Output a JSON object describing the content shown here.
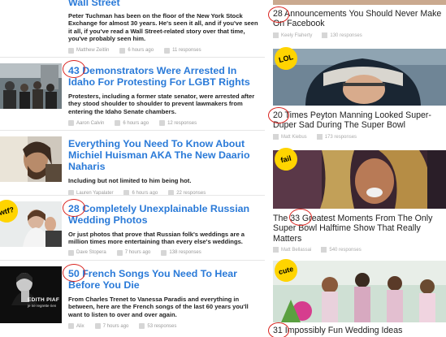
{
  "left_articles": [
    {
      "title": "Wall Street",
      "description": "Peter Tuchman has been on the floor of the New York Stock Exchange for almost 30 years. He's seen it all, and if you've seen it all, if you've read a Wall Street-related story over that time, you've probably seen him.",
      "author": "Matthew Zeitlin",
      "time": "6 hours ago",
      "responses": "11 responses"
    },
    {
      "title": "43 Demonstrators Were Arrested In Idaho For Protesting For LGBT Rights",
      "description": "Protesters, including a former state senator, were arrested after they stood shoulder to shoulder to prevent lawmakers from entering the Idaho Senate chambers.",
      "author": "Aaron Calvin",
      "time": "6 hours ago",
      "responses": "12 responses"
    },
    {
      "title": "Everything You Need To Know About Michiel Huisman AKA The New Daario Naharis",
      "description": "Including but not limited to him being hot.",
      "author": "Lauren Yapalater",
      "time": "6 hours ago",
      "responses": "22 responses"
    },
    {
      "title": "28 Completely Unexplainable Russian Wedding Photos",
      "description": "Or just photos that prove that Russian folk's weddings are a million times more entertaining than every else's weddings.",
      "author": "Dave Stopera",
      "time": "7 hours ago",
      "responses": "138 responses",
      "badge": "wtf?"
    },
    {
      "title": "50 French Songs You Need To Hear Before You Die",
      "description": "From Charles Trenet to Vanessa Paradis and everything in between, here are the French songs of the last 60 years you'll want to listen to over and over again.",
      "author": "Alix",
      "time": "7 hours ago",
      "responses": "53 responses",
      "thumb_caption_1": "EDITH PIAF",
      "thumb_caption_2": "je ne regrette rien"
    }
  ],
  "right_articles": [
    {
      "title": "28 Announcements You Should Never Make On Facebook",
      "author": "Keely Flaherty",
      "time": "",
      "responses": "130 responses"
    },
    {
      "title": "20 Times Peyton Manning Looked Super-Duper Sad During The Super Bowl",
      "author": "Matt Kiebus",
      "responses": "173 responses",
      "badge": "LOL"
    },
    {
      "title": "The 33 Greatest Moments From The Only Super Bowl Halftime Show That Really Matters",
      "author": "Matt Bellassai",
      "responses": "540 responses",
      "badge": "fail"
    },
    {
      "title": "31 Impossibly Fun Wedding Ideas",
      "badge": "cute"
    }
  ],
  "colors": {
    "link": "#2a7ad8",
    "circle": "#d9231e",
    "badge": "#ffd400"
  }
}
